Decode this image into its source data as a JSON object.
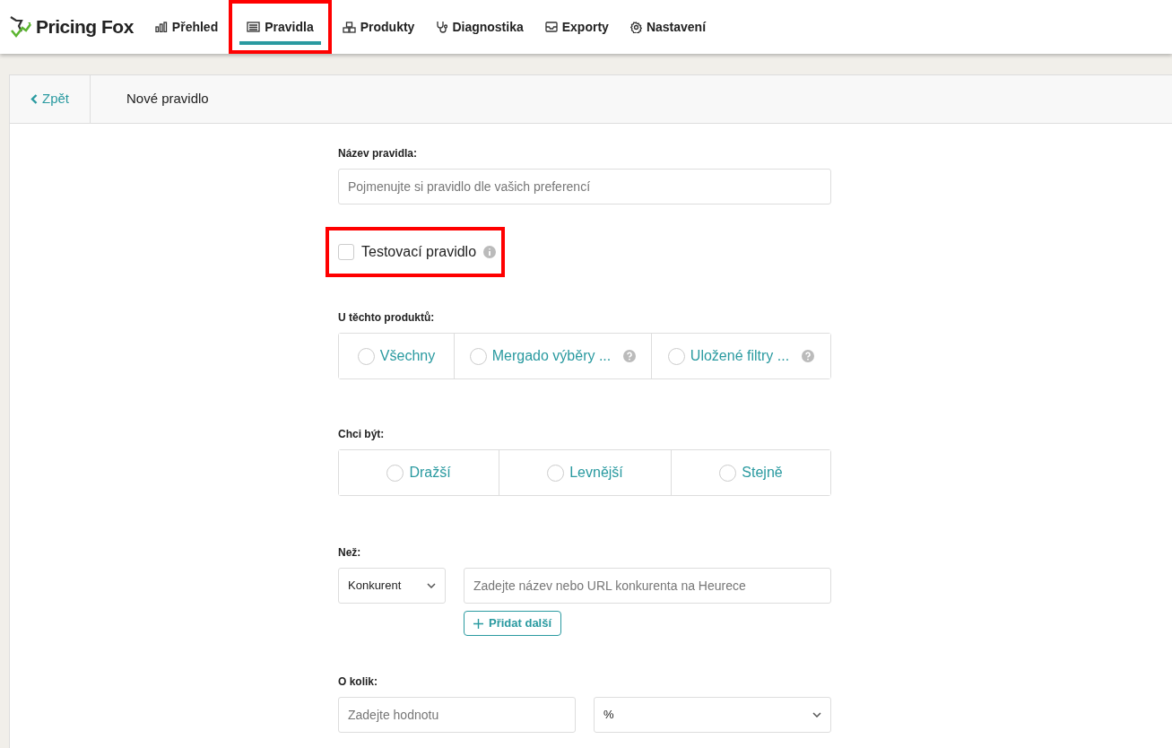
{
  "brand": "Pricing Fox",
  "nav": [
    {
      "label": "Přehled",
      "selected": false,
      "highlighted": false
    },
    {
      "label": "Pravidla",
      "selected": true,
      "highlighted": true
    },
    {
      "label": "Produkty",
      "selected": false,
      "highlighted": false
    },
    {
      "label": "Diagnostika",
      "selected": false,
      "highlighted": false
    },
    {
      "label": "Exporty",
      "selected": false,
      "highlighted": false
    },
    {
      "label": "Nastavení",
      "selected": false,
      "highlighted": false
    }
  ],
  "header": {
    "back": "Zpět",
    "title": "Nové pravidlo"
  },
  "name_field": {
    "label": "Název pravidla:",
    "placeholder": "Pojmenujte si pravidlo dle vašich preferencí"
  },
  "test_rule": {
    "label": "Testovací pravidlo",
    "checked": false,
    "highlighted": true
  },
  "products": {
    "label": "U těchto produktů:",
    "options": [
      {
        "label": "Všechny",
        "selected": false,
        "help": false
      },
      {
        "label": "Mergado výběry ...",
        "selected": false,
        "help": true
      },
      {
        "label": "Uložené filtry ...",
        "selected": false,
        "help": true
      }
    ]
  },
  "want": {
    "label": "Chci být:",
    "options": [
      {
        "label": "Dražší",
        "selected": false
      },
      {
        "label": "Levnější",
        "selected": false
      },
      {
        "label": "Stejně",
        "selected": false
      }
    ]
  },
  "than": {
    "label": "Než:",
    "select": "Konkurent",
    "placeholder": "Zadejte název nebo URL konkurenta na Heurece",
    "add_button": "Přidat další"
  },
  "amount": {
    "label": "O kolik:",
    "placeholder": "Zadejte hodnotu",
    "unit": "%"
  }
}
